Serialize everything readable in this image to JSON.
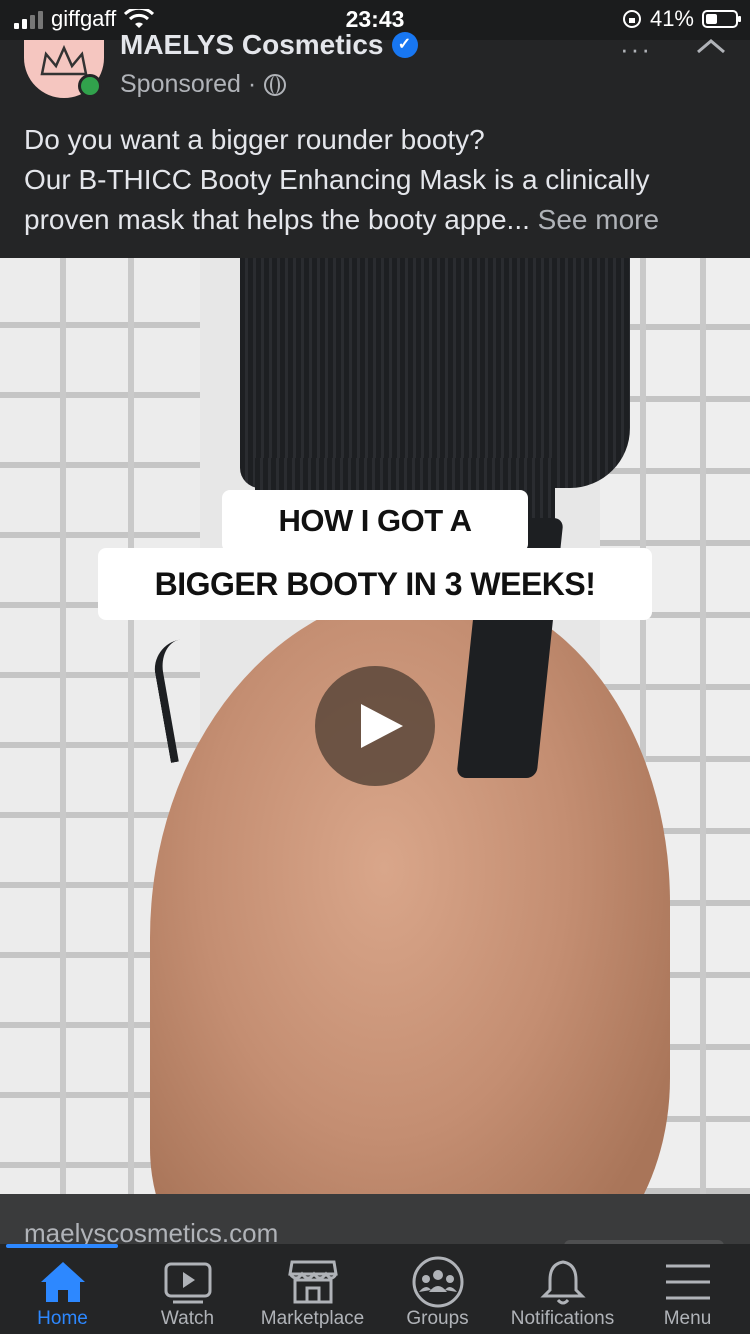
{
  "status_bar": {
    "carrier": "giffgaff",
    "time": "23:43",
    "battery": "41%",
    "battery_level": 0.41
  },
  "post": {
    "page_name": "MAELYS Cosmetics",
    "sponsored": "Sponsored ·",
    "text_line1": "Do you want a bigger rounder booty?",
    "text_line2": "Our B-THICC Booty Enhancing Mask is a clinically proven mask that helps the booty appe...",
    "see_more": "See more",
    "more_dots": "···"
  },
  "media": {
    "caption_line1": "HOW I GOT A",
    "caption_line2": "BIGGER BOOTY IN 3 WEEKS!"
  },
  "link": {
    "domain": "maelyscosmetics.com"
  },
  "tabbar": {
    "tabs": [
      {
        "label": "Home",
        "icon": "home-icon"
      },
      {
        "label": "Watch",
        "icon": "watch-icon"
      },
      {
        "label": "Marketplace",
        "icon": "marketplace-icon"
      },
      {
        "label": "Groups",
        "icon": "groups-icon"
      },
      {
        "label": "Notifications",
        "icon": "bell-icon"
      },
      {
        "label": "Menu",
        "icon": "menu-icon"
      }
    ]
  },
  "colors": {
    "accent": "#2d88ff",
    "verified": "#1877f2",
    "online": "#31a24c",
    "background": "#242526"
  }
}
